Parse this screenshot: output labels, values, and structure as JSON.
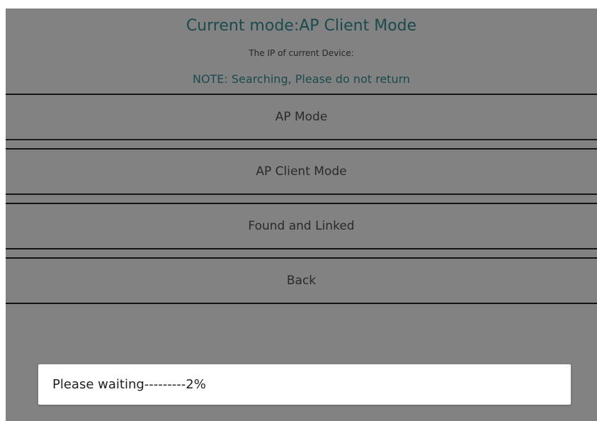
{
  "header": {
    "title": "Current mode:AP Client Mode",
    "ip_label": "The IP of current Device:",
    "note": "NOTE: Searching, Please do not return"
  },
  "buttons": [
    {
      "label": "AP Mode"
    },
    {
      "label": "AP Client Mode"
    },
    {
      "label": "Found and Linked"
    },
    {
      "label": "Back"
    }
  ],
  "progress_dialog": {
    "text": "Please waiting---------2%",
    "progress_percent": 2
  },
  "colors": {
    "overlay_background": "#828282",
    "title_text": "#1c4a4d",
    "dialog_background": "#ffffff"
  }
}
